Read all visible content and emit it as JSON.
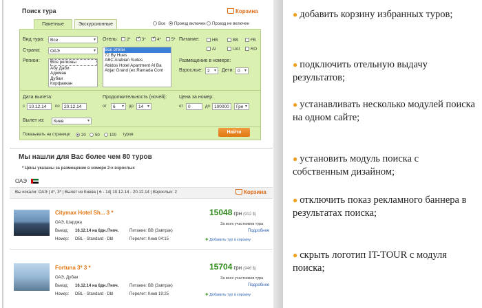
{
  "form": {
    "title": "Поиск тура",
    "cart": "Корзина",
    "tabs": [
      "Пакетные",
      "Экскурсионные"
    ],
    "radios": [
      {
        "label": "Все",
        "on": false
      },
      {
        "label": "Проезд включен",
        "on": true
      },
      {
        "label": "Проезд не включен",
        "on": false
      }
    ],
    "tour_type_label": "Вид тура:",
    "tour_type": "Все",
    "country_label": "Страна:",
    "country": "ОАЭ",
    "region_label": "Регион:",
    "regions": [
      "Все регионы",
      "Абу Даби",
      "Аджман",
      "Дубаи",
      "Корфаккан"
    ],
    "hotel_label": "Отель:",
    "stars": [
      {
        "label": "2*",
        "on": false
      },
      {
        "label": "3*",
        "on": true
      },
      {
        "label": "4*",
        "on": true
      },
      {
        "label": "5*",
        "on": false
      }
    ],
    "hotels": [
      "Все отели",
      "72 By Hues",
      "ABC Arabian Suites",
      "Abidos Hotel Apartment Al Ba",
      "Abjar Grand (ex.Ramada Cont"
    ],
    "meal_label": "Питание:",
    "meals": [
      {
        "label": "HB",
        "on": false
      },
      {
        "label": "BB",
        "on": false
      },
      {
        "label": "FB",
        "on": false
      },
      {
        "label": "AI",
        "on": false
      },
      {
        "label": "UAI",
        "on": false
      },
      {
        "label": "RO",
        "on": false
      }
    ],
    "room_label": "Размещение в номере:",
    "adults_label": "Взрослые:",
    "adults": "2",
    "kids_label": "Дети:",
    "kids": "0",
    "date_label": "Дата вылета:",
    "date_from_pre": "с",
    "date_from": "10.12.14",
    "date_to_pre": "по",
    "date_to": "20.12.14",
    "nights_label": "Продолжительность (ночей):",
    "nights_from_pre": "от",
    "nights_from": "6",
    "nights_to_pre": "до",
    "nights_to": "14",
    "price_label": "Цена за номер:",
    "price_from_pre": "от",
    "price_from": "0",
    "price_to_pre": "до",
    "price_to": "100000",
    "currency": "Грн",
    "depart_label": "Вылет из:",
    "depart": "Киев",
    "button": "Найти",
    "per_page_label": "Показывать на странице",
    "per_page": [
      {
        "label": "20",
        "on": true
      },
      {
        "label": "50",
        "on": false
      },
      {
        "label": "100",
        "on": false
      }
    ],
    "per_page_suffix": "туров"
  },
  "results": {
    "found": "Мы нашли для Вас более чем 80 туров",
    "note": "* Цены указаны за размещение в номере 2-х взрослых",
    "country": "ОАЭ",
    "search_summary": "Вы искали:  ОАЭ | 4*, 3* | Вылет из Киева | 6 - 14| 10.12.14 - 20.12.14 | Взрослых: 2",
    "cart": "Корзина",
    "hotels": [
      {
        "name": "Citymax Hotel Sh... 3 *",
        "location": "ОАЭ, Шарджа",
        "depart_label": "Выезд:",
        "depart": "16.12.14 на 8дн./7ноч.",
        "meal_label": "Питание:",
        "meal": "BB (Завтрак)",
        "room_label": "Номер:",
        "room": "DBL - Standard - Dbl",
        "flight_label": "Перелет:",
        "flight": "Киев 04:15",
        "price": "15048",
        "currency": "грн",
        "alt_price": "(912 $)",
        "note": "За всех участников тура",
        "more": "Подробнее",
        "add": "Добавить тур в корзину"
      },
      {
        "name": "Fortuna 3* 3 *",
        "location": "ОАЭ, Дубаи",
        "depart_label": "Выезд:",
        "depart": "16.12.14 на 8дн./7ноч.",
        "meal_label": "Питание:",
        "meal": "BB (Завтрак)",
        "room_label": "Номер:",
        "room": "DBL - Standard - Dbl",
        "flight_label": "Перелет:",
        "flight": "Киев 19:25",
        "price": "15704",
        "currency": "грн",
        "alt_price": "(946 $)",
        "note": "За всех участников тура",
        "more": "Подробнее",
        "add": "Добавить тур в корзину"
      }
    ]
  },
  "features": [
    "добавить корзину избранных туров;",
    "подключить отельную выдачу результатов;",
    "устанавливать несколько модулей поиска на одном сайте;",
    "установить модуль поиска с собственным дизайном;",
    "отключить показ рекламного баннера в результатах поиска;",
    "скрыть логотип IT-TOUR с модуля поиска;"
  ],
  "colors": {
    "accent": "#e07612",
    "panel": "#d9f0b0",
    "price": "#2f8a1a",
    "bullet": "#f0a020"
  }
}
